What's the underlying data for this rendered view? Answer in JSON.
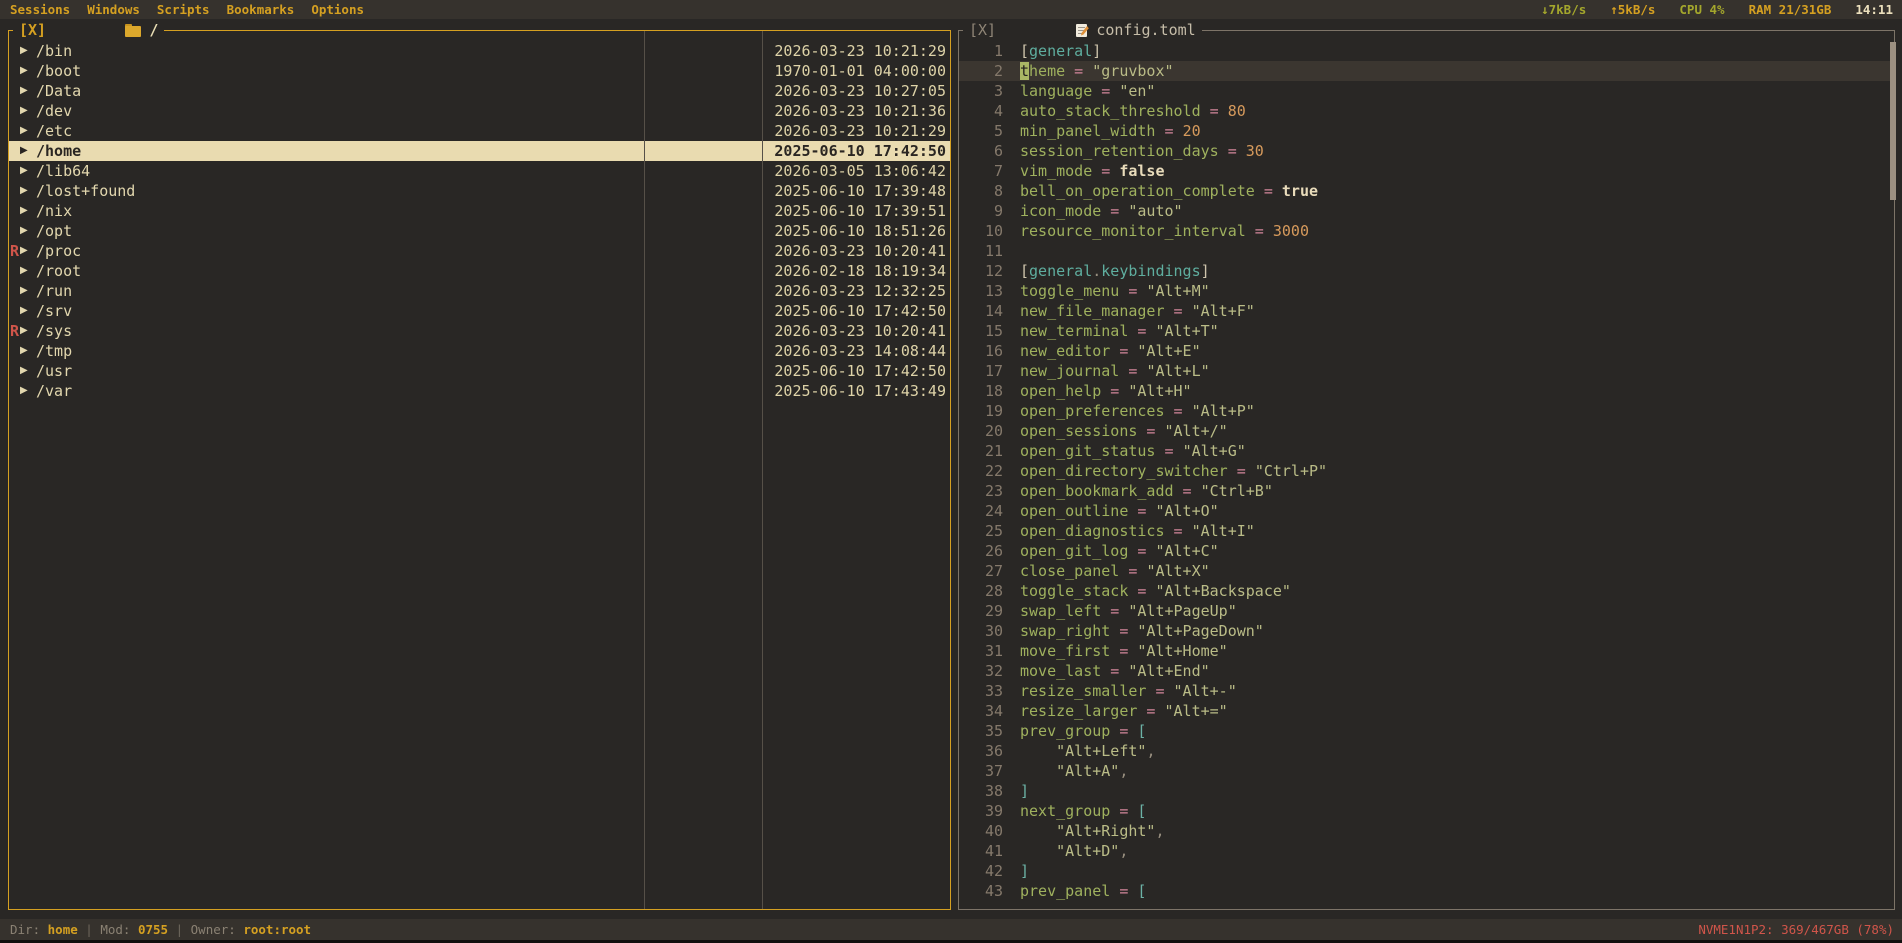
{
  "menubar": {
    "items": [
      "Sessions",
      "Windows",
      "Scripts",
      "Bookmarks",
      "Options"
    ],
    "net_down": "↓7kB/s",
    "net_up": "↑5kB/s",
    "cpu": "CPU 4%",
    "ram": "RAM 21/31GB",
    "clock": "14:11"
  },
  "file_manager": {
    "close_label": "[X]",
    "folder_icon": "folder-icon",
    "path": "/",
    "arrow_icon": "▶",
    "rows": [
      {
        "marker": "",
        "name": "/bin",
        "date": "2026-03-23 10:21:29",
        "selected": false
      },
      {
        "marker": "",
        "name": "/boot",
        "date": "1970-01-01 04:00:00",
        "selected": false
      },
      {
        "marker": "",
        "name": "/Data",
        "date": "2026-03-23 10:27:05",
        "selected": false
      },
      {
        "marker": "",
        "name": "/dev",
        "date": "2026-03-23 10:21:36",
        "selected": false
      },
      {
        "marker": "",
        "name": "/etc",
        "date": "2026-03-23 10:21:29",
        "selected": false
      },
      {
        "marker": "",
        "name": "/home",
        "date": "2025-06-10 17:42:50",
        "selected": true
      },
      {
        "marker": "",
        "name": "/lib64",
        "date": "2026-03-05 13:06:42",
        "selected": false
      },
      {
        "marker": "",
        "name": "/lost+found",
        "date": "2025-06-10 17:39:48",
        "selected": false
      },
      {
        "marker": "",
        "name": "/nix",
        "date": "2025-06-10 17:39:51",
        "selected": false
      },
      {
        "marker": "",
        "name": "/opt",
        "date": "2025-06-10 18:51:26",
        "selected": false
      },
      {
        "marker": "R",
        "name": "/proc",
        "date": "2026-03-23 10:20:41",
        "selected": false
      },
      {
        "marker": "",
        "name": "/root",
        "date": "2026-02-18 18:19:34",
        "selected": false
      },
      {
        "marker": "",
        "name": "/run",
        "date": "2026-03-23 12:32:25",
        "selected": false
      },
      {
        "marker": "",
        "name": "/srv",
        "date": "2025-06-10 17:42:50",
        "selected": false
      },
      {
        "marker": "R",
        "name": "/sys",
        "date": "2026-03-23 10:20:41",
        "selected": false
      },
      {
        "marker": "",
        "name": "/tmp",
        "date": "2026-03-23 14:08:44",
        "selected": false
      },
      {
        "marker": "",
        "name": "/usr",
        "date": "2025-06-10 17:42:50",
        "selected": false
      },
      {
        "marker": "",
        "name": "/var",
        "date": "2025-06-10 17:43:49",
        "selected": false
      }
    ]
  },
  "editor": {
    "close_label": "[X]",
    "memo_icon": "memo-pencil-icon",
    "filename": "config.toml",
    "lines": [
      {
        "n": 1,
        "cur": false,
        "seg": [
          [
            "B",
            "["
          ],
          [
            "S",
            "general"
          ],
          [
            "B",
            "]"
          ]
        ]
      },
      {
        "n": 2,
        "cur": true,
        "seg": [
          [
            "C",
            "t"
          ],
          [
            "k",
            "heme"
          ],
          [
            "e",
            " = "
          ],
          [
            "s",
            "\"gruvbox\""
          ]
        ]
      },
      {
        "n": 3,
        "cur": false,
        "seg": [
          [
            "k",
            "language"
          ],
          [
            "e",
            " = "
          ],
          [
            "s",
            "\"en\""
          ]
        ]
      },
      {
        "n": 4,
        "cur": false,
        "seg": [
          [
            "k",
            "auto_stack_threshold"
          ],
          [
            "e",
            " = "
          ],
          [
            "n",
            "80"
          ]
        ]
      },
      {
        "n": 5,
        "cur": false,
        "seg": [
          [
            "k",
            "min_panel_width"
          ],
          [
            "e",
            " = "
          ],
          [
            "n",
            "20"
          ]
        ]
      },
      {
        "n": 6,
        "cur": false,
        "seg": [
          [
            "k",
            "session_retention_days"
          ],
          [
            "e",
            " = "
          ],
          [
            "n",
            "30"
          ]
        ]
      },
      {
        "n": 7,
        "cur": false,
        "seg": [
          [
            "k",
            "vim_mode"
          ],
          [
            "e",
            " = "
          ],
          [
            "b",
            "false"
          ]
        ]
      },
      {
        "n": 8,
        "cur": false,
        "seg": [
          [
            "k",
            "bell_on_operation_complete"
          ],
          [
            "e",
            " = "
          ],
          [
            "b",
            "true"
          ]
        ]
      },
      {
        "n": 9,
        "cur": false,
        "seg": [
          [
            "k",
            "icon_mode"
          ],
          [
            "e",
            " = "
          ],
          [
            "s",
            "\"auto\""
          ]
        ]
      },
      {
        "n": 10,
        "cur": false,
        "seg": [
          [
            "k",
            "resource_monitor_interval"
          ],
          [
            "e",
            " = "
          ],
          [
            "n",
            "3000"
          ]
        ]
      },
      {
        "n": 11,
        "cur": false,
        "seg": []
      },
      {
        "n": 12,
        "cur": false,
        "seg": [
          [
            "B",
            "["
          ],
          [
            "S",
            "general"
          ],
          [
            "p",
            "."
          ],
          [
            "S",
            "keybindings"
          ],
          [
            "B",
            "]"
          ]
        ]
      },
      {
        "n": 13,
        "cur": false,
        "seg": [
          [
            "k",
            "toggle_menu"
          ],
          [
            "e",
            " = "
          ],
          [
            "s",
            "\"Alt+M\""
          ]
        ]
      },
      {
        "n": 14,
        "cur": false,
        "seg": [
          [
            "k",
            "new_file_manager"
          ],
          [
            "e",
            " = "
          ],
          [
            "s",
            "\"Alt+F\""
          ]
        ]
      },
      {
        "n": 15,
        "cur": false,
        "seg": [
          [
            "k",
            "new_terminal"
          ],
          [
            "e",
            " = "
          ],
          [
            "s",
            "\"Alt+T\""
          ]
        ]
      },
      {
        "n": 16,
        "cur": false,
        "seg": [
          [
            "k",
            "new_editor"
          ],
          [
            "e",
            " = "
          ],
          [
            "s",
            "\"Alt+E\""
          ]
        ]
      },
      {
        "n": 17,
        "cur": false,
        "seg": [
          [
            "k",
            "new_journal"
          ],
          [
            "e",
            " = "
          ],
          [
            "s",
            "\"Alt+L\""
          ]
        ]
      },
      {
        "n": 18,
        "cur": false,
        "seg": [
          [
            "k",
            "open_help"
          ],
          [
            "e",
            " = "
          ],
          [
            "s",
            "\"Alt+H\""
          ]
        ]
      },
      {
        "n": 19,
        "cur": false,
        "seg": [
          [
            "k",
            "open_preferences"
          ],
          [
            "e",
            " = "
          ],
          [
            "s",
            "\"Alt+P\""
          ]
        ]
      },
      {
        "n": 20,
        "cur": false,
        "seg": [
          [
            "k",
            "open_sessions"
          ],
          [
            "e",
            " = "
          ],
          [
            "s",
            "\"Alt+/\""
          ]
        ]
      },
      {
        "n": 21,
        "cur": false,
        "seg": [
          [
            "k",
            "open_git_status"
          ],
          [
            "e",
            " = "
          ],
          [
            "s",
            "\"Alt+G\""
          ]
        ]
      },
      {
        "n": 22,
        "cur": false,
        "seg": [
          [
            "k",
            "open_directory_switcher"
          ],
          [
            "e",
            " = "
          ],
          [
            "s",
            "\"Ctrl+P\""
          ]
        ]
      },
      {
        "n": 23,
        "cur": false,
        "seg": [
          [
            "k",
            "open_bookmark_add"
          ],
          [
            "e",
            " = "
          ],
          [
            "s",
            "\"Ctrl+B\""
          ]
        ]
      },
      {
        "n": 24,
        "cur": false,
        "seg": [
          [
            "k",
            "open_outline"
          ],
          [
            "e",
            " = "
          ],
          [
            "s",
            "\"Alt+O\""
          ]
        ]
      },
      {
        "n": 25,
        "cur": false,
        "seg": [
          [
            "k",
            "open_diagnostics"
          ],
          [
            "e",
            " = "
          ],
          [
            "s",
            "\"Alt+I\""
          ]
        ]
      },
      {
        "n": 26,
        "cur": false,
        "seg": [
          [
            "k",
            "open_git_log"
          ],
          [
            "e",
            " = "
          ],
          [
            "s",
            "\"Alt+C\""
          ]
        ]
      },
      {
        "n": 27,
        "cur": false,
        "seg": [
          [
            "k",
            "close_panel"
          ],
          [
            "e",
            " = "
          ],
          [
            "s",
            "\"Alt+X\""
          ]
        ]
      },
      {
        "n": 28,
        "cur": false,
        "seg": [
          [
            "k",
            "toggle_stack"
          ],
          [
            "e",
            " = "
          ],
          [
            "s",
            "\"Alt+Backspace\""
          ]
        ]
      },
      {
        "n": 29,
        "cur": false,
        "seg": [
          [
            "k",
            "swap_left"
          ],
          [
            "e",
            " = "
          ],
          [
            "s",
            "\"Alt+PageUp\""
          ]
        ]
      },
      {
        "n": 30,
        "cur": false,
        "seg": [
          [
            "k",
            "swap_right"
          ],
          [
            "e",
            " = "
          ],
          [
            "s",
            "\"Alt+PageDown\""
          ]
        ]
      },
      {
        "n": 31,
        "cur": false,
        "seg": [
          [
            "k",
            "move_first"
          ],
          [
            "e",
            " = "
          ],
          [
            "s",
            "\"Alt+Home\""
          ]
        ]
      },
      {
        "n": 32,
        "cur": false,
        "seg": [
          [
            "k",
            "move_last"
          ],
          [
            "e",
            " = "
          ],
          [
            "s",
            "\"Alt+End\""
          ]
        ]
      },
      {
        "n": 33,
        "cur": false,
        "seg": [
          [
            "k",
            "resize_smaller"
          ],
          [
            "e",
            " = "
          ],
          [
            "s",
            "\"Alt+-\""
          ]
        ]
      },
      {
        "n": 34,
        "cur": false,
        "seg": [
          [
            "k",
            "resize_larger"
          ],
          [
            "e",
            " = "
          ],
          [
            "s",
            "\"Alt+=\""
          ]
        ]
      },
      {
        "n": 35,
        "cur": false,
        "seg": [
          [
            "k",
            "prev_group"
          ],
          [
            "e",
            " = "
          ],
          [
            "A",
            "["
          ]
        ]
      },
      {
        "n": 36,
        "cur": false,
        "seg": [
          [
            "t",
            "    "
          ],
          [
            "s",
            "\"Alt+Left\""
          ],
          [
            "p",
            ","
          ]
        ]
      },
      {
        "n": 37,
        "cur": false,
        "seg": [
          [
            "t",
            "    "
          ],
          [
            "s",
            "\"Alt+A\""
          ],
          [
            "p",
            ","
          ]
        ]
      },
      {
        "n": 38,
        "cur": false,
        "seg": [
          [
            "A",
            "]"
          ]
        ]
      },
      {
        "n": 39,
        "cur": false,
        "seg": [
          [
            "k",
            "next_group"
          ],
          [
            "e",
            " = "
          ],
          [
            "A",
            "["
          ]
        ]
      },
      {
        "n": 40,
        "cur": false,
        "seg": [
          [
            "t",
            "    "
          ],
          [
            "s",
            "\"Alt+Right\""
          ],
          [
            "p",
            ","
          ]
        ]
      },
      {
        "n": 41,
        "cur": false,
        "seg": [
          [
            "t",
            "    "
          ],
          [
            "s",
            "\"Alt+D\""
          ],
          [
            "p",
            ","
          ]
        ]
      },
      {
        "n": 42,
        "cur": false,
        "seg": [
          [
            "A",
            "]"
          ]
        ]
      },
      {
        "n": 43,
        "cur": false,
        "seg": [
          [
            "k",
            "prev_panel"
          ],
          [
            "e",
            " = "
          ],
          [
            "A",
            "["
          ]
        ]
      }
    ]
  },
  "statusbar": {
    "dir_label": "Dir: ",
    "dir_value": "home",
    "separator": " | ",
    "mod_label": "Mod: ",
    "mod_value": "0755",
    "owner_label": "Owner: ",
    "owner_value": "root:root",
    "disk": "NVME1N1P2: 369/467GB (78%)"
  },
  "colors": {
    "accent_yellow": "#d5a021",
    "selection_bg": "#e9dbb0",
    "alert_red": "#d0554a",
    "cursor_green": "#a9b665",
    "panel_border_inactive": "#7d7468"
  }
}
